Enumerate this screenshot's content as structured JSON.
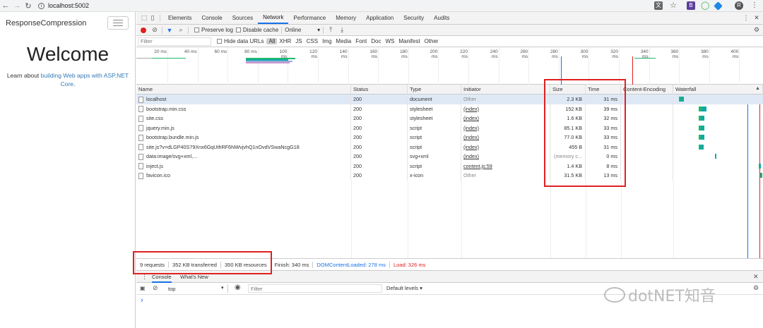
{
  "browser": {
    "url": "localhost:5002",
    "ext_b_label": "B",
    "avatar_label": "R"
  },
  "page": {
    "app_title": "ResponseCompression",
    "welcome": "Welcome",
    "learn_prefix": "Learn about ",
    "learn_link": "building Web apps with ASP.NET Core",
    "learn_suffix": "."
  },
  "devtools": {
    "tabs": [
      "Elements",
      "Console",
      "Sources",
      "Network",
      "Performance",
      "Memory",
      "Application",
      "Security",
      "Audits"
    ],
    "active_tab": "Network",
    "toolbar": {
      "preserve_log": "Preserve log",
      "disable_cache": "Disable cache",
      "throttle": "Online"
    },
    "filter": {
      "placeholder": "Filter",
      "hide_data_urls": "Hide data URLs",
      "types": [
        "All",
        "XHR",
        "JS",
        "CSS",
        "Img",
        "Media",
        "Font",
        "Doc",
        "WS",
        "Manifest",
        "Other"
      ],
      "selected": "All"
    },
    "timeline_ticks": [
      "20 ms",
      "40 ms",
      "60 ms",
      "80 ms",
      "100 ms",
      "120 ms",
      "140 ms",
      "160 ms",
      "180 ms",
      "200 ms",
      "220 ms",
      "240 ms",
      "260 ms",
      "280 ms",
      "300 ms",
      "320 ms",
      "340 ms",
      "360 ms",
      "380 ms",
      "400 ms",
      "42"
    ],
    "columns": {
      "name": "Name",
      "status": "Status",
      "type": "Type",
      "initiator": "Initiator",
      "size": "Size",
      "time": "Time",
      "encoding": "Content-Encoding",
      "waterfall": "Waterfall"
    },
    "rows": [
      {
        "name": "localhost",
        "status": "200",
        "type": "document",
        "initiator": "Other",
        "size": "2.3 KB",
        "time": "31 ms",
        "wf_start": 0.04,
        "wf_len": 0.06
      },
      {
        "name": "bootstrap.min.css",
        "status": "200",
        "type": "stylesheet",
        "initiator": "(index)",
        "size": "152 KB",
        "time": "39 ms",
        "wf_start": 0.27,
        "wf_len": 0.09
      },
      {
        "name": "site.css",
        "status": "200",
        "type": "stylesheet",
        "initiator": "(index)",
        "size": "1.6 KB",
        "time": "32 ms",
        "wf_start": 0.27,
        "wf_len": 0.07
      },
      {
        "name": "jquery.min.js",
        "status": "200",
        "type": "script",
        "initiator": "(index)",
        "size": "85.1 KB",
        "time": "33 ms",
        "wf_start": 0.27,
        "wf_len": 0.07
      },
      {
        "name": "bootstrap.bundle.min.js",
        "status": "200",
        "type": "script",
        "initiator": "(index)",
        "size": "77.0 KB",
        "time": "33 ms",
        "wf_start": 0.27,
        "wf_len": 0.07
      },
      {
        "name": "site.js?v=dLGP40S79Xnx6GqUthRF6NWvjvhQ1nOvdVSwaNcgG18",
        "status": "200",
        "type": "script",
        "initiator": "(index)",
        "size": "455 B",
        "time": "31 ms",
        "wf_start": 0.27,
        "wf_len": 0.06
      },
      {
        "name": "data:image/svg+xml,...",
        "status": "200",
        "type": "svg+xml",
        "initiator": "(index)",
        "size": "(memory c...",
        "time": "0 ms",
        "wf_start": 0.46,
        "wf_len": 0.01
      },
      {
        "name": "inject.js",
        "status": "200",
        "type": "script",
        "initiator": "content.js:59",
        "size": "1.4 KB",
        "time": "8 ms",
        "wf_start": 0.97,
        "wf_len": 0.02
      },
      {
        "name": "favicon.ico",
        "status": "200",
        "type": "x-icon",
        "initiator": "Other",
        "size": "31.5 KB",
        "time": "13 ms",
        "wf_start": 0.98,
        "wf_len": 0.03
      }
    ],
    "status": {
      "requests": "9 requests",
      "transferred": "352 KB transferred",
      "resources": "350 KB resources",
      "finish": "Finish: 340 ms",
      "dcl": "DOMContentLoaded: 278 ms",
      "load": "Load: 326 ms"
    },
    "drawer": {
      "tabs": [
        "Console",
        "What's New"
      ],
      "context": "top",
      "filter_placeholder": "Filter",
      "levels": "Default levels",
      "prompt": "›"
    },
    "colors": {
      "dcl": "#1a73e8",
      "load": "#e02020",
      "accent": "#1a73e8",
      "wf_green": "#1fb86b",
      "wf_teal": "#12a8a8"
    }
  },
  "watermark": "dotNET知音"
}
